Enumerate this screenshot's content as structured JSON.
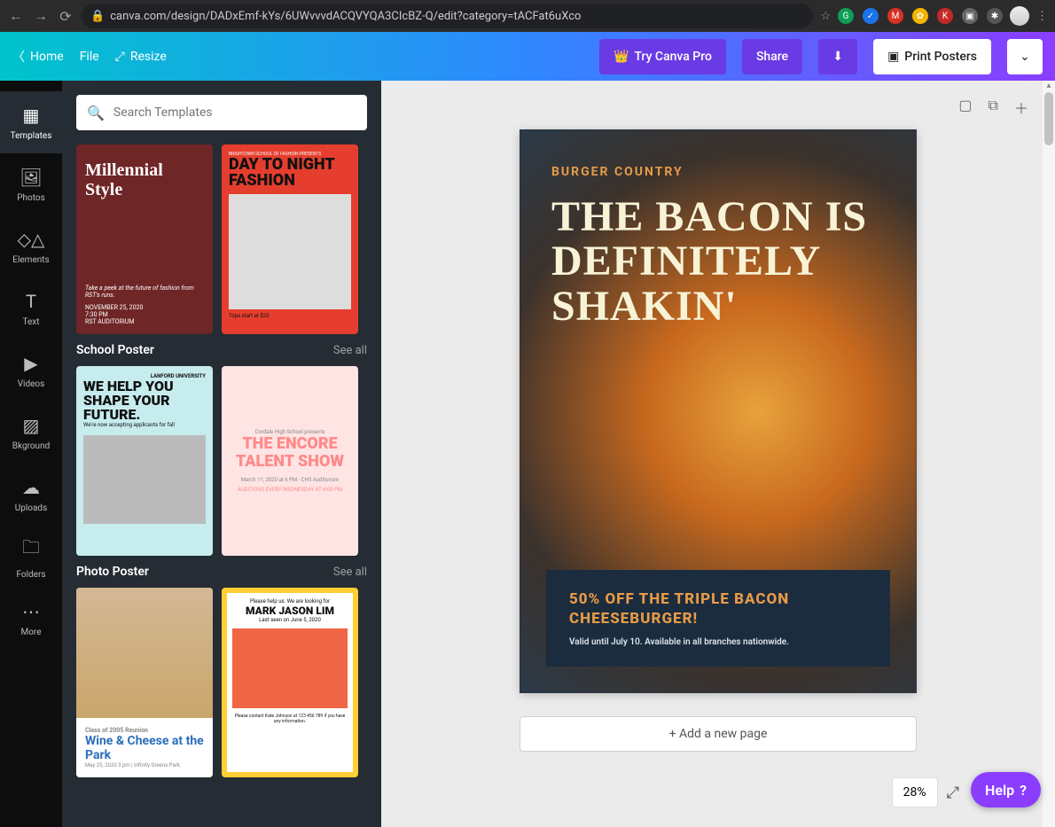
{
  "browser": {
    "url": "canva.com/design/DADxEmf-kYs/6UWvvvdACQVYQA3CIcBZ-Q/edit?category=tACFat6uXco"
  },
  "toolbar": {
    "home": "Home",
    "file": "File",
    "resize": "Resize",
    "try_pro": "Try Canva Pro",
    "share": "Share",
    "print": "Print Posters"
  },
  "rail": {
    "items": [
      {
        "label": "Templates"
      },
      {
        "label": "Photos"
      },
      {
        "label": "Elements"
      },
      {
        "label": "Text"
      },
      {
        "label": "Videos"
      },
      {
        "label": "Bkground"
      },
      {
        "label": "Uploads"
      },
      {
        "label": "Folders"
      },
      {
        "label": "More"
      }
    ]
  },
  "search": {
    "placeholder": "Search Templates"
  },
  "sections": [
    {
      "title": "",
      "see_all": "",
      "templates": [
        {
          "title": "Millennial Style",
          "sub": "Take a peek at the future of fashion from RST's runs.",
          "date": "NOVEMBER 25, 2020",
          "time": "7:30 PM",
          "venue": "RST AUDITORIUM"
        },
        {
          "pretitle": "BRIGHTOWN SCHOOL OF FASHION PRESENTS",
          "title": "DAY TO NIGHT FASHION",
          "note": "Tops start at $25"
        }
      ]
    },
    {
      "title": "School Poster",
      "see_all": "See all",
      "templates": [
        {
          "badge": "LANFORD UNIVERSITY",
          "title": "WE HELP YOU SHAPE YOUR FUTURE.",
          "sub": "We're now accepting applicants for fall"
        },
        {
          "pretitle": "Cordale High School presents",
          "title": "THE ENCORE TALENT SHOW",
          "sub": "March 11, 2020 at 6 PM · CHS Auditorium",
          "sub2": "AUDITIONS EVERY WEDNESDAY AT 4:00 PM"
        }
      ]
    },
    {
      "title": "Photo Poster",
      "see_all": "See all",
      "templates": [
        {
          "pretitle": "Class of 2005 Reunion",
          "title": "Wine & Cheese at the Park",
          "sub": "May 25, 2020 3 pm | Infinity Greens Park"
        },
        {
          "pretitle": "Please help us. We are looking for",
          "title": "MARK JASON LIM",
          "sub": "Last seen on June 5, 2020",
          "contact": "Please contact Kate Johnson at 123 456 789 if you have any information."
        }
      ]
    }
  ],
  "poster": {
    "brand": "BURGER COUNTRY",
    "headline": "THE BACON IS DEFINITELY SHAKIN'",
    "promo": "50% OFF THE TRIPLE BACON CHEESEBURGER!",
    "valid": "Valid until July 10. Available in all branches nationwide."
  },
  "canvas": {
    "add_page": "+ Add a new page",
    "zoom": "28%",
    "help": "Help"
  }
}
